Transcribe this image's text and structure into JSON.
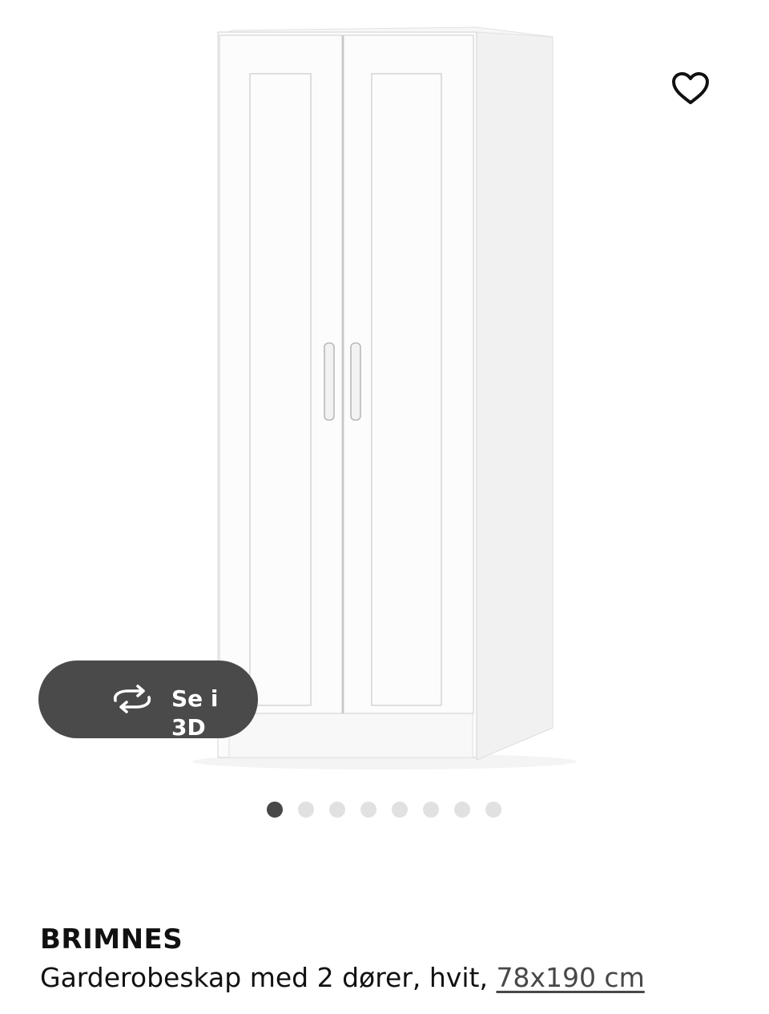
{
  "product": {
    "name": "BRIMNES",
    "description": "Garderobeskap med 2 dører, hvit, ",
    "size": "78x190 cm"
  },
  "actions": {
    "view3d_label": "Se i 3D",
    "favorite_icon": "heart-outline-icon",
    "view3d_icon": "rotate-arrows-icon"
  },
  "carousel": {
    "total_images": 8,
    "active_index": 0
  },
  "colors": {
    "pill_background": "#4a4a4a",
    "dot_active": "#484848",
    "dot_inactive": "#e1e1e1"
  }
}
